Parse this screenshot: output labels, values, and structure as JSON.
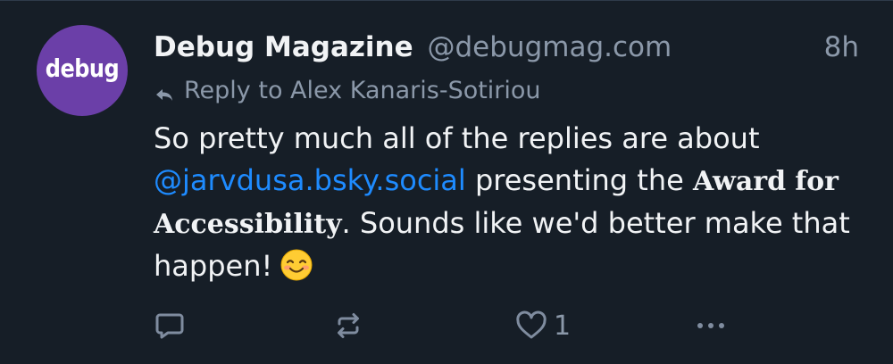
{
  "post": {
    "avatar_text": "debug",
    "author_name": "Debug Magazine",
    "author_handle": "@debugmag.com",
    "timestamp": "8h",
    "reply_to": "Reply to Alex Kanaris-Sotiriou",
    "text_part1": "So pretty much all of the replies are about",
    "mention": "@jarvdusa.bsky.social",
    "text_part2": " presenting the ",
    "bold_phrase_line1": "Award",
    "bold_phrase_line2": "for Accessibility",
    "text_part3": ". Sounds like we'd better make that happen!",
    "emoji": "smiling-face-with-smiling-eyes"
  },
  "actions": {
    "reply_icon": "comment-icon",
    "repost_icon": "repost-icon",
    "like_icon": "heart-icon",
    "like_count": "1",
    "more_icon": "more-dots-icon"
  },
  "colors": {
    "background": "#161e27",
    "text": "#f1f3f5",
    "muted": "#8b98a9",
    "link": "#1e8bff",
    "avatar_bg": "#6b3fa8"
  }
}
